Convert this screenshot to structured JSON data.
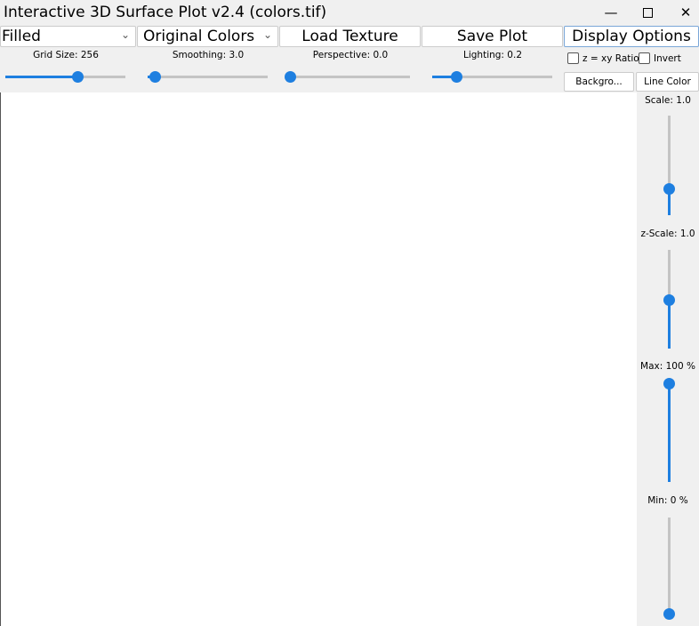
{
  "window": {
    "title": "Interactive 3D Surface Plot v2.4  (colors.tif)"
  },
  "toolbar": {
    "render_mode": "Filled",
    "color_mode": "Original Colors",
    "load_texture": "Load Texture",
    "save_plot": "Save Plot",
    "display_options": "Display Options"
  },
  "sliders": {
    "grid_size": {
      "label": "Grid Size: 256",
      "fraction": 0.6
    },
    "smoothing": {
      "label": "Smoothing: 3.0",
      "fraction": 0.06
    },
    "perspective": {
      "label": "Perspective: 0.0",
      "fraction": 0.0
    },
    "lighting": {
      "label": "Lighting: 0.2",
      "fraction": 0.2
    }
  },
  "options": {
    "z_xy_ratio": "z = xy Ratio",
    "invert": "Invert",
    "background": "Backgro...",
    "line_color": "Line Color"
  },
  "side": {
    "scale": {
      "label": "Scale: 1.0",
      "fraction": 0.27
    },
    "z_scale": {
      "label": "z-Scale: 1.0",
      "fraction": 0.5
    },
    "max": {
      "label": "Max: 100 %",
      "fraction": 1.0
    },
    "min": {
      "label": "Min: 0 %",
      "fraction": 0.0
    }
  },
  "colors": {
    "accent": "#1e7fe0"
  }
}
